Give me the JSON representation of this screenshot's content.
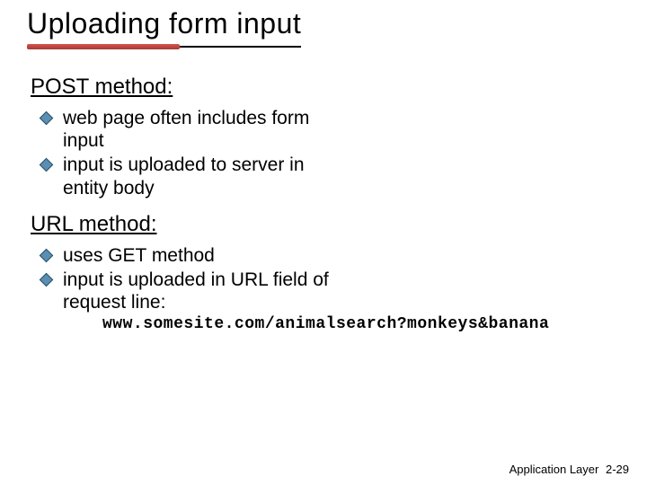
{
  "title": "Uploading form input",
  "sections": [
    {
      "heading": "POST method:",
      "items": [
        "web page often includes form input",
        "input is uploaded to server in entity body"
      ]
    },
    {
      "heading": "URL method:",
      "items": [
        "uses GET method",
        "input is uploaded in URL field of request line:"
      ]
    }
  ],
  "url_example": "www.somesite.com/animalsearch?monkeys&banana",
  "footer": {
    "label": "Application Layer",
    "page": "2-29"
  }
}
